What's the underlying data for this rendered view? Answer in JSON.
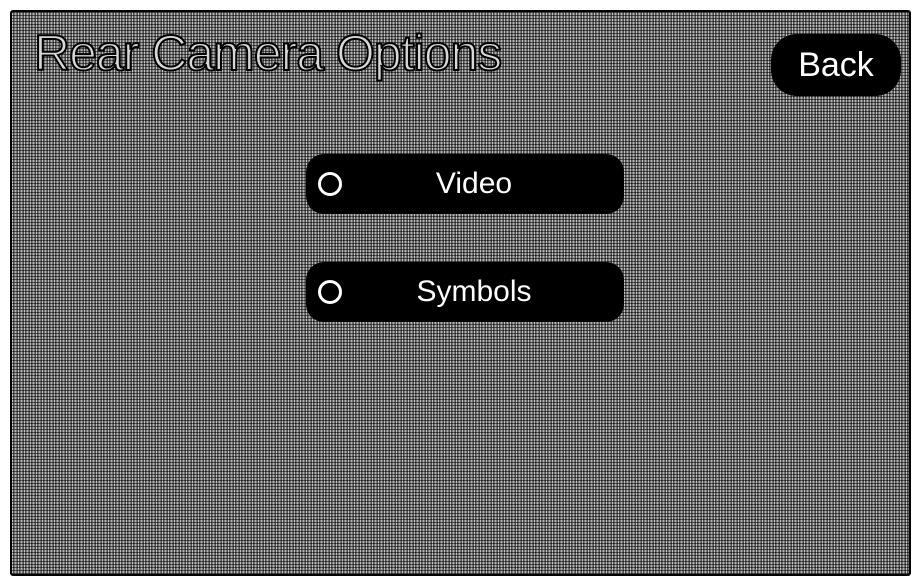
{
  "header": {
    "title": "Rear Camera Options",
    "back_label": "Back"
  },
  "options": [
    {
      "label": "Video",
      "selected": false
    },
    {
      "label": "Symbols",
      "selected": false
    }
  ]
}
